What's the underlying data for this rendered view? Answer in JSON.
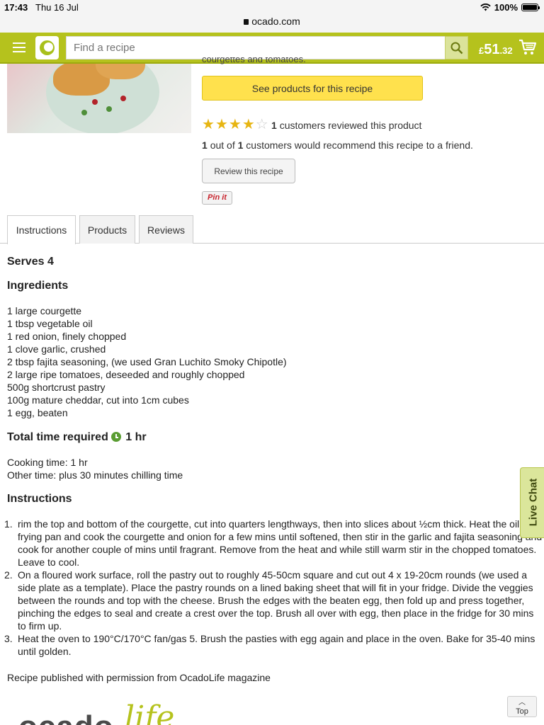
{
  "status_bar": {
    "time": "17:43",
    "date": "Thu 16 Jul",
    "battery": "100%"
  },
  "browser": {
    "url": "ocado.com"
  },
  "header": {
    "search_placeholder": "Find a recipe",
    "price_main": "51",
    "price_pence": ".32",
    "price_symbol": "£",
    "brand_color": "#b5c21d"
  },
  "recipe": {
    "cut_text": "courgettes and tomatoes.",
    "see_products_label": "See products for this recipe",
    "rating_stars": 4,
    "rating_max": 5,
    "review_count": "1",
    "review_text": "customers reviewed this product",
    "recommend_a": "1",
    "recommend_out_of": "out of",
    "recommend_b": "1",
    "recommend_text": "customers would recommend this recipe to a friend.",
    "review_button_label": "Review this recipe",
    "pinit_label": "Pin it"
  },
  "tabs": [
    {
      "label": "Instructions",
      "active": true
    },
    {
      "label": "Products",
      "active": false
    },
    {
      "label": "Reviews",
      "active": false
    }
  ],
  "content": {
    "serves": "Serves 4",
    "ingredients_heading": "Ingredients",
    "ingredients": [
      "1 large courgette",
      "1 tbsp vegetable oil",
      "1 red onion, finely chopped",
      "1 clove garlic, crushed",
      "2 tbsp fajita seasoning, (we used Gran Luchito Smoky Chipotle)",
      "2 large ripe tomatoes, deseeded and roughly chopped",
      "500g shortcrust pastry",
      "100g mature cheddar, cut into 1cm cubes",
      "1 egg, beaten"
    ],
    "total_time_label": "Total time required",
    "total_time_value": "1 hr",
    "cooking_time": "Cooking time: 1 hr",
    "other_time": "Other time: plus 30 minutes chilling time",
    "instructions_heading": "Instructions",
    "steps": [
      "rim the top and bottom of the courgette, cut into quarters lengthways, then into slices about ½cm thick. Heat the oil in a frying pan and cook the courgette and onion for a few mins until softened, then stir in the garlic and fajita seasoning and cook for another couple of mins until fragrant. Remove from the heat and while still warm stir in the chopped tomatoes. Leave to cool.",
      "On a floured work surface, roll the pastry out to roughly 45-50cm square and cut out 4 x 19-20cm rounds (we used a side plate as a template). Place the pastry rounds on a lined baking sheet that will fit in your fridge. Divide the veggies between the rounds and top with the cheese. Brush the edges with the beaten egg, then fold up and press together, pinching the edges to seal and create a crest over the top. Brush all over with egg, then place in the fridge for 30 mins to firm up.",
      "Heat the oven to 190°C/170°C fan/gas 5. Brush the pasties with egg again and place in the oven. Bake for 35-40 mins until golden."
    ],
    "published": "Recipe published with permission from OcadoLife magazine",
    "logo_text_a": "ocado",
    "logo_text_b": "life"
  },
  "widgets": {
    "live_chat": "Live Chat",
    "top": "Top"
  }
}
